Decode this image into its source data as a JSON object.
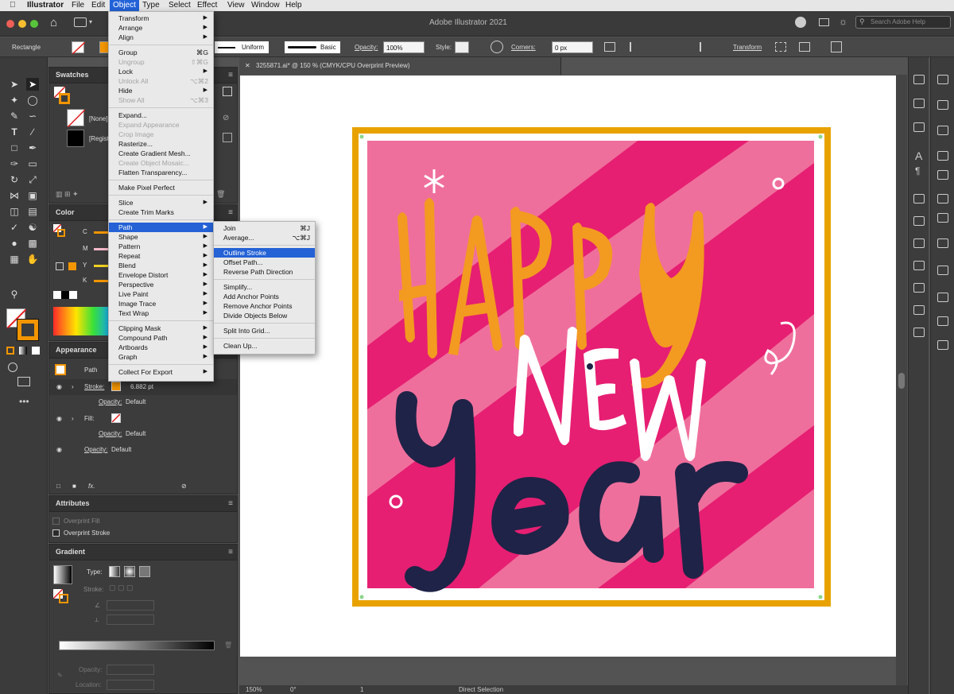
{
  "menubar": {
    "apple": "",
    "app": "Illustrator",
    "items": [
      "File",
      "Edit",
      "Object",
      "Type",
      "Select",
      "Effect",
      "View",
      "Window",
      "Help"
    ]
  },
  "window": {
    "title": "Adobe Illustrator 2021",
    "search_placeholder": "Search Adobe Help"
  },
  "control": {
    "tool_name": "Rectangle",
    "stroke_profile": "Uniform",
    "brush": "Basic",
    "opacity_label": "Opacity:",
    "opacity_value": "100%",
    "style_label": "Style:",
    "corners_label": "Corners:",
    "corners_value": "0 px",
    "transform_label": "Transform"
  },
  "doc": {
    "tab_title": "3255871.ai* @ 150 % (CMYK/CPU Overprint Preview)",
    "zoom": "150%",
    "rotation": "0°",
    "artboard_num": "1",
    "tool_status": "Direct Selection"
  },
  "swatches": {
    "title": "Swatches",
    "rows": [
      "[None]",
      "[Regist"
    ]
  },
  "color": {
    "title": "Color",
    "channels": [
      "C",
      "M",
      "Y",
      "K"
    ]
  },
  "appearance": {
    "title": "Appearance",
    "object": "Path",
    "stroke_label": "Stroke:",
    "stroke_value": "6.882 pt",
    "opacity_label": "Opacity:",
    "opacity_value": "Default",
    "fill_label": "Fill:",
    "fx": "fx."
  },
  "attributes": {
    "title": "Attributes",
    "overprint_fill": "Overprint Fill",
    "overprint_stroke": "Overprint Stroke"
  },
  "gradient": {
    "title": "Gradient",
    "type_label": "Type:",
    "stroke_label": "Stroke:",
    "opacity_label": "Opacity:",
    "location_label": "Location:"
  },
  "object_menu": {
    "items": [
      {
        "label": "Transform",
        "sub": true
      },
      {
        "label": "Arrange",
        "sub": true
      },
      {
        "label": "Align",
        "sub": true
      },
      {
        "sep": true
      },
      {
        "label": "Group",
        "sc": "⌘G"
      },
      {
        "label": "Ungroup",
        "sc": "⇧⌘G",
        "dis": true
      },
      {
        "label": "Lock",
        "sub": true
      },
      {
        "label": "Unlock All",
        "sc": "⌥⌘2",
        "dis": true
      },
      {
        "label": "Hide",
        "sub": true
      },
      {
        "label": "Show All",
        "sc": "⌥⌘3",
        "dis": true
      },
      {
        "sep": true
      },
      {
        "label": "Expand..."
      },
      {
        "label": "Expand Appearance",
        "dis": true
      },
      {
        "label": "Crop Image",
        "dis": true
      },
      {
        "label": "Rasterize..."
      },
      {
        "label": "Create Gradient Mesh..."
      },
      {
        "label": "Create Object Mosaic...",
        "dis": true
      },
      {
        "label": "Flatten Transparency..."
      },
      {
        "sep": true
      },
      {
        "label": "Make Pixel Perfect"
      },
      {
        "sep": true
      },
      {
        "label": "Slice",
        "sub": true
      },
      {
        "label": "Create Trim Marks"
      },
      {
        "sep": true
      },
      {
        "label": "Path",
        "sub": true,
        "hl": true
      },
      {
        "label": "Shape",
        "sub": true
      },
      {
        "label": "Pattern",
        "sub": true
      },
      {
        "label": "Repeat",
        "sub": true
      },
      {
        "label": "Blend",
        "sub": true
      },
      {
        "label": "Envelope Distort",
        "sub": true
      },
      {
        "label": "Perspective",
        "sub": true
      },
      {
        "label": "Live Paint",
        "sub": true
      },
      {
        "label": "Image Trace",
        "sub": true
      },
      {
        "label": "Text Wrap",
        "sub": true
      },
      {
        "sep": true
      },
      {
        "label": "Clipping Mask",
        "sub": true
      },
      {
        "label": "Compound Path",
        "sub": true
      },
      {
        "label": "Artboards",
        "sub": true
      },
      {
        "label": "Graph",
        "sub": true
      },
      {
        "sep": true
      },
      {
        "label": "Collect For Export",
        "sub": true
      }
    ]
  },
  "path_menu": {
    "items": [
      {
        "label": "Join",
        "sc": "⌘J"
      },
      {
        "label": "Average...",
        "sc": "⌥⌘J"
      },
      {
        "sep": true
      },
      {
        "label": "Outline Stroke",
        "hl": true
      },
      {
        "label": "Offset Path..."
      },
      {
        "label": "Reverse Path Direction"
      },
      {
        "sep": true
      },
      {
        "label": "Simplify..."
      },
      {
        "label": "Add Anchor Points"
      },
      {
        "label": "Remove Anchor Points"
      },
      {
        "label": "Divide Objects Below"
      },
      {
        "sep": true
      },
      {
        "label": "Split Into Grid..."
      },
      {
        "sep": true
      },
      {
        "label": "Clean Up..."
      }
    ]
  },
  "artwork": {
    "line1": "HAPPY",
    "line2": "NEW",
    "line3": "Year",
    "frame_color": "#e8a200",
    "bg_color": "#e61f72",
    "stripe_color": "#ef6f9c",
    "orange": "#f39a20",
    "navy": "#1f2347"
  },
  "icons": [
    "apple-icon",
    "home-icon",
    "selection-icon",
    "direct-selection-icon",
    "pen-icon",
    "type-icon",
    "line-icon",
    "rectangle-icon",
    "brush-icon",
    "pencil-icon",
    "eraser-icon",
    "rotate-icon",
    "scale-icon",
    "warp-icon",
    "shape-builder-icon",
    "gradient-icon",
    "eyedropper-icon",
    "blend-icon",
    "symbol-icon",
    "column-graph-icon",
    "artboard-icon",
    "slice-icon",
    "hand-icon",
    "zoom-icon"
  ]
}
